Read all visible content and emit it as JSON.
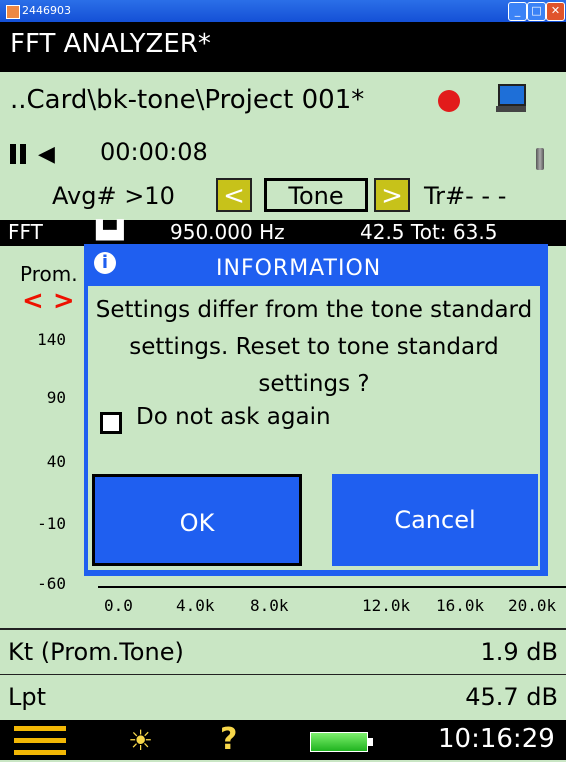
{
  "window": {
    "title": "2446903"
  },
  "app": {
    "title": "FFT ANALYZER*"
  },
  "project": {
    "path": "..Card\\bk-tone\\Project 001*"
  },
  "status": {
    "elapsed": "00:00:08"
  },
  "avg": {
    "label": "Avg# >10",
    "mode": "Tone",
    "trigger": "Tr#- - -"
  },
  "measurement": {
    "type": "FFT",
    "freq": "950.000 Hz",
    "level": "42.5 Tot: 63.5"
  },
  "chart": {
    "label": "Prom.",
    "y_ticks": [
      "140",
      "90",
      "40",
      "-10",
      "-60"
    ],
    "x_ticks": [
      "0.0",
      "4.0k",
      "8.0k",
      "12.0k",
      "16.0k",
      "20.0k"
    ]
  },
  "dialog": {
    "title": "INFORMATION",
    "message": "Settings differ from the tone standard settings. Reset to tone standard settings ?",
    "checkbox_label": "Do not ask again",
    "ok": "OK",
    "cancel": "Cancel"
  },
  "readouts": [
    {
      "label": "Kt (Prom.Tone)",
      "value": "1.9 dB"
    },
    {
      "label": "Lpt",
      "value": "45.7 dB"
    }
  ],
  "taskbar": {
    "clock": "10:16:29"
  },
  "colors": {
    "accent": "#1f5ff0",
    "background": "#c9e6c4",
    "nav": "#c7c21a"
  }
}
